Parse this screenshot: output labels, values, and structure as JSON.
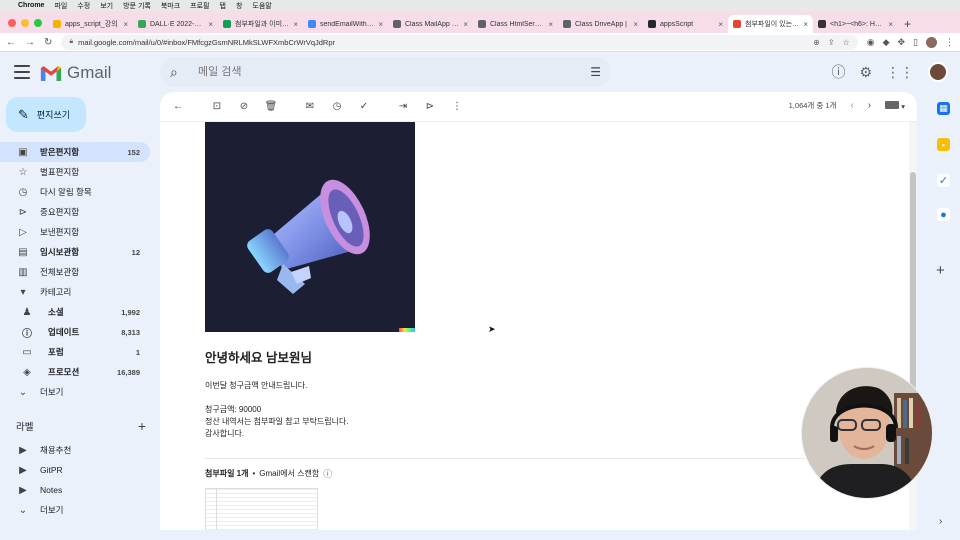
{
  "menubar": {
    "app": "Chrome",
    "items": [
      "파일",
      "수정",
      "보기",
      "방문 기록",
      "북마크",
      "프로필",
      "탭",
      "창",
      "도움말"
    ]
  },
  "tabs": [
    {
      "title": "apps_script_강의",
      "color": "#f4b400",
      "active": false
    },
    {
      "title": "DALL·E 2022-08-",
      "color": "#34a853",
      "active": false
    },
    {
      "title": "첨부파일과 이미지가",
      "color": "#0f9d58",
      "active": false
    },
    {
      "title": "sendEmailWithFile",
      "color": "#4285f4",
      "active": false
    },
    {
      "title": "Class MailApp | A",
      "color": "#5f6368",
      "active": false
    },
    {
      "title": "Class HtmlService",
      "color": "#5f6368",
      "active": false
    },
    {
      "title": "Class DriveApp |",
      "color": "#5f6368",
      "active": false
    },
    {
      "title": "appsScript",
      "color": "#24292e",
      "active": false
    },
    {
      "title": "첨부파일이 있는 이미지",
      "color": "#ea4335",
      "active": true
    },
    {
      "title": "<h1>~<h6>: HTML",
      "color": "#333333",
      "active": false
    }
  ],
  "address": {
    "url": "mail.google.com/mail/u/0/#inbox/FMfcgzGsmNRLMkSLWFXmbCrWrVqJdRpr"
  },
  "gmail": {
    "logo_text": "Gmail",
    "search_placeholder": "메일 검색",
    "compose_label": "편지쓰기"
  },
  "nav": [
    {
      "label": "받은편지함",
      "count": "152",
      "icon": "inbox-icon",
      "glyph": "▣",
      "state": "active"
    },
    {
      "label": "별표편지함",
      "count": "",
      "icon": "star-icon",
      "glyph": "☆",
      "state": ""
    },
    {
      "label": "다시 알림 항목",
      "count": "",
      "icon": "clock-icon",
      "glyph": "◷",
      "state": ""
    },
    {
      "label": "중요편지함",
      "count": "",
      "icon": "important-icon",
      "glyph": "⊳",
      "state": ""
    },
    {
      "label": "보낸편지함",
      "count": "",
      "icon": "send-icon",
      "glyph": "▷",
      "state": ""
    },
    {
      "label": "임시보관함",
      "count": "12",
      "icon": "draft-icon",
      "glyph": "▤",
      "state": "bold"
    },
    {
      "label": "전체보관함",
      "count": "",
      "icon": "all-mail-icon",
      "glyph": "▥",
      "state": ""
    },
    {
      "label": "카테고리",
      "count": "",
      "icon": "category-icon",
      "glyph": "▾",
      "state": ""
    },
    {
      "label": "소셜",
      "count": "1,992",
      "icon": "people-icon",
      "glyph": "♟",
      "state": "bold sub"
    },
    {
      "label": "업데이트",
      "count": "8,313",
      "icon": "info-icon",
      "glyph": "ⓘ",
      "state": "bold sub"
    },
    {
      "label": "포럼",
      "count": "1",
      "icon": "forum-icon",
      "glyph": "▭",
      "state": "bold sub"
    },
    {
      "label": "프로모션",
      "count": "16,389",
      "icon": "tag-icon",
      "glyph": "◈",
      "state": "bold sub"
    },
    {
      "label": "더보기",
      "count": "",
      "icon": "chevron-down-icon",
      "glyph": "⌄",
      "state": ""
    }
  ],
  "labels": {
    "heading": "라벨",
    "items": [
      {
        "label": "채용추천",
        "icon": "label-icon",
        "glyph": "▶"
      },
      {
        "label": "GitPR",
        "icon": "label-icon",
        "glyph": "▶"
      },
      {
        "label": "Notes",
        "icon": "label-icon",
        "glyph": "▶"
      },
      {
        "label": "더보기",
        "icon": "chevron-down-icon",
        "glyph": "⌄"
      }
    ]
  },
  "pager": {
    "text": "1,064개 중 1개"
  },
  "message": {
    "title": "안녕하세요 남보원님",
    "lines": [
      "이번달 청구금액 안내드립니다.",
      "",
      "청구금액: 90000",
      "정산 내역서는 첨부파일 참고 부탁드립니다.",
      "감사합니다."
    ],
    "attachments_label": "첨부파일 1개",
    "bullet": "•",
    "scan_label": "Gmail에서 스캔함"
  },
  "colors": {
    "compose_bg": "#c2e7ff",
    "active_nav": "#d3e3fd",
    "page_bg": "#eaf1fb",
    "tabstrip": "#f6dde9"
  }
}
